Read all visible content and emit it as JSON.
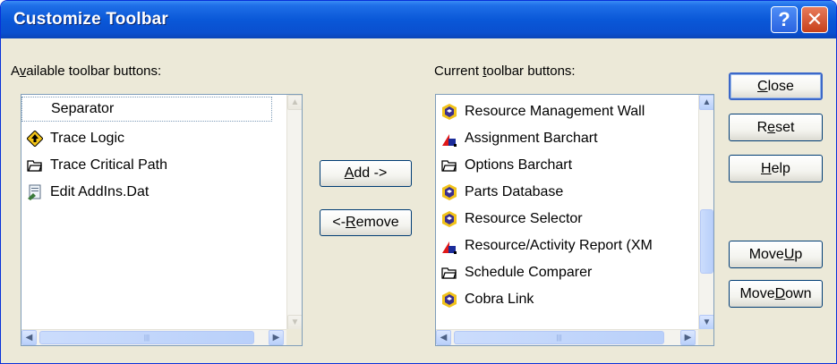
{
  "window": {
    "title": "Customize Toolbar",
    "help_glyph": "?",
    "close_glyph": "✕"
  },
  "available": {
    "label_pre": "A",
    "label_u": "v",
    "label_post": "ailable toolbar buttons:",
    "items": [
      {
        "label": "Separator",
        "icon": "none"
      },
      {
        "label": "Trace Logic",
        "icon": "diamond-arrow-icon"
      },
      {
        "label": "Trace Critical Path",
        "icon": "folder-icon"
      },
      {
        "label": "Edit AddIns.Dat",
        "icon": "edit-document-icon"
      }
    ]
  },
  "current": {
    "label_pre": "Current ",
    "label_u": "t",
    "label_post": "oolbar buttons:",
    "items": [
      {
        "label": "Resource Management Wall",
        "icon": "hex-badge-icon"
      },
      {
        "label": "Assignment Barchart",
        "icon": "shapes-icon"
      },
      {
        "label": "Options Barchart",
        "icon": "folder-icon"
      },
      {
        "label": "Parts Database",
        "icon": "hex-badge-icon"
      },
      {
        "label": "Resource Selector",
        "icon": "hex-badge-icon"
      },
      {
        "label": "Resource/Activity Report (XM",
        "icon": "shapes-icon"
      },
      {
        "label": "Schedule Comparer",
        "icon": "folder-icon"
      },
      {
        "label": "Cobra Link",
        "icon": "hex-badge-icon"
      }
    ]
  },
  "buttons": {
    "add": {
      "u": "A",
      "rest": "dd ->"
    },
    "remove": {
      "pre": "<- ",
      "u": "R",
      "rest": "emove"
    },
    "close": {
      "u": "C",
      "rest": "lose"
    },
    "reset": {
      "pre": "R",
      "u": "e",
      "rest": "set"
    },
    "help": {
      "u": "H",
      "rest": "elp"
    },
    "move_up": {
      "pre": "Move ",
      "u": "U",
      "rest": "p"
    },
    "move_down": {
      "pre": "Move ",
      "u": "D",
      "rest": "own"
    }
  },
  "scroll_glyphs": {
    "up": "▲",
    "down": "▼",
    "left": "◀",
    "right": "▶",
    "grip": "|||"
  },
  "colors": {
    "title_bar": "#0a58d8",
    "selection_border": "#7f9db9",
    "dialog": "#ece9d8"
  }
}
